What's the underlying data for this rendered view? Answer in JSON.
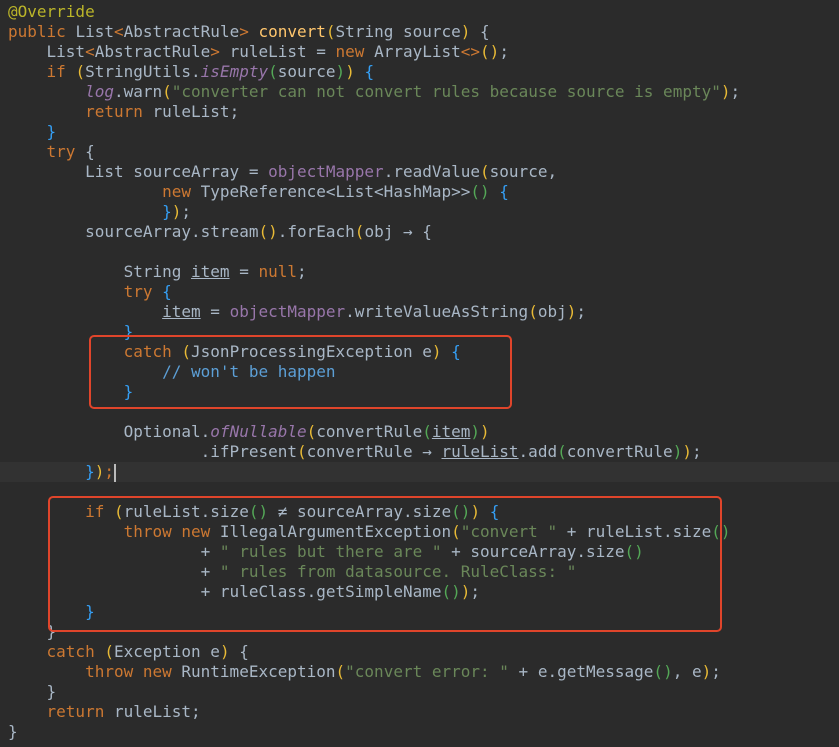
{
  "colors": {
    "background": "#2b2b2b",
    "highlight_box": "#e0452b",
    "keyword": "#cc7832",
    "string": "#6a8759",
    "method": "#ffc66d"
  },
  "current_line": 23,
  "lines": [
    [
      [
        "a",
        "@Override"
      ]
    ],
    [
      [
        "kw",
        "public "
      ],
      [
        "t",
        "List"
      ],
      [
        "kw",
        "<"
      ],
      [
        "t",
        "AbstractRule"
      ],
      [
        "kw",
        "> "
      ],
      [
        "m",
        "convert"
      ],
      [
        "b1",
        "("
      ],
      [
        "t",
        "String source"
      ],
      [
        "b1",
        ")"
      ],
      [
        "t",
        " {"
      ]
    ],
    [
      [
        "t",
        "    List"
      ],
      [
        "kw",
        "<"
      ],
      [
        "t",
        "AbstractRule"
      ],
      [
        "kw",
        "> "
      ],
      [
        "t",
        "ruleList = "
      ],
      [
        "kw",
        "new "
      ],
      [
        "t",
        "ArrayList"
      ],
      [
        "kw",
        "<>"
      ],
      [
        "b1",
        "("
      ],
      [
        "b1",
        ")"
      ],
      [
        "t",
        ";"
      ]
    ],
    [
      [
        "kw",
        "    if "
      ],
      [
        "b1",
        "("
      ],
      [
        "t",
        "StringUtils."
      ],
      [
        "st",
        "isEmpty"
      ],
      [
        "b2",
        "("
      ],
      [
        "t",
        "source"
      ],
      [
        "b2",
        ")"
      ],
      [
        "b1",
        ")"
      ],
      [
        "b3",
        " {"
      ]
    ],
    [
      [
        "t",
        "        "
      ],
      [
        "st",
        "log"
      ],
      [
        "t",
        ".warn"
      ],
      [
        "b1",
        "("
      ],
      [
        "s",
        "\"converter can not convert rules because source is empty\""
      ],
      [
        "b1",
        ")"
      ],
      [
        "t",
        ";"
      ]
    ],
    [
      [
        "kw",
        "        return "
      ],
      [
        "t",
        "ruleList;"
      ]
    ],
    [
      [
        "b3",
        "    }"
      ]
    ],
    [
      [
        "kw",
        "    try "
      ],
      [
        "t",
        "{"
      ]
    ],
    [
      [
        "t",
        "        List sourceArray = "
      ],
      [
        "f",
        "objectMapper"
      ],
      [
        "t",
        ".readValue"
      ],
      [
        "b1",
        "("
      ],
      [
        "t",
        "source,"
      ]
    ],
    [
      [
        "kw",
        "                new "
      ],
      [
        "t",
        "TypeReference<List<HashMap>>"
      ],
      [
        "b2",
        "("
      ],
      [
        "b2",
        ")"
      ],
      [
        "b3",
        " {"
      ]
    ],
    [
      [
        "b3",
        "                }"
      ],
      [
        "b1",
        ")"
      ],
      [
        "t",
        ";"
      ]
    ],
    [
      [
        "t",
        "        sourceArray.stream"
      ],
      [
        "b1",
        "("
      ],
      [
        "b1",
        ")"
      ],
      [
        "t",
        ".forEach"
      ],
      [
        "b1",
        "("
      ],
      [
        "t",
        "obj → {"
      ]
    ],
    [],
    [
      [
        "t",
        "            String "
      ],
      [
        "u",
        "item"
      ],
      [
        "t",
        " = "
      ],
      [
        "kw",
        "null"
      ],
      [
        "t",
        ";"
      ]
    ],
    [
      [
        "kw",
        "            try "
      ],
      [
        "b3",
        "{"
      ]
    ],
    [
      [
        "t",
        "                "
      ],
      [
        "u",
        "item"
      ],
      [
        "t",
        " = "
      ],
      [
        "f",
        "objectMapper"
      ],
      [
        "t",
        ".writeValueAsString"
      ],
      [
        "b1",
        "("
      ],
      [
        "t",
        "obj"
      ],
      [
        "b1",
        ")"
      ],
      [
        "t",
        ";"
      ]
    ],
    [
      [
        "b3",
        "            }"
      ]
    ],
    [
      [
        "kw",
        "            catch "
      ],
      [
        "b1",
        "("
      ],
      [
        "t",
        "JsonProcessingException e"
      ],
      [
        "b1",
        ")"
      ],
      [
        "b3",
        " {"
      ]
    ],
    [
      [
        "c",
        "                // won't be happen"
      ]
    ],
    [
      [
        "b3",
        "            }"
      ]
    ],
    [],
    [
      [
        "t",
        "            Optional."
      ],
      [
        "st",
        "ofNullable"
      ],
      [
        "b1",
        "("
      ],
      [
        "t",
        "convertRule"
      ],
      [
        "b2",
        "("
      ],
      [
        "u",
        "item"
      ],
      [
        "b2",
        ")"
      ],
      [
        "b1",
        ")"
      ]
    ],
    [
      [
        "t",
        "                    .ifPresent"
      ],
      [
        "b1",
        "("
      ],
      [
        "t",
        "convertRule → "
      ],
      [
        "u",
        "ruleList"
      ],
      [
        "t",
        ".add"
      ],
      [
        "b2",
        "("
      ],
      [
        "t",
        "convertRule"
      ],
      [
        "b2",
        ")"
      ],
      [
        "b1",
        ")"
      ],
      [
        "t",
        ";"
      ]
    ],
    [
      [
        "b3",
        "        }"
      ],
      [
        "b1",
        ")"
      ],
      [
        "kw",
        ";"
      ]
    ],
    [],
    [
      [
        "kw",
        "        if "
      ],
      [
        "b1",
        "("
      ],
      [
        "t",
        "ruleList.size"
      ],
      [
        "b2",
        "("
      ],
      [
        "b2",
        ")"
      ],
      [
        "t",
        " ≠ sourceArray.size"
      ],
      [
        "b2",
        "("
      ],
      [
        "b2",
        ")"
      ],
      [
        "b1",
        ")"
      ],
      [
        "b3",
        " {"
      ]
    ],
    [
      [
        "kw",
        "            throw new "
      ],
      [
        "t",
        "IllegalArgumentException"
      ],
      [
        "b1",
        "("
      ],
      [
        "s",
        "\"convert \""
      ],
      [
        "t",
        " + ruleList.size"
      ],
      [
        "b2",
        "("
      ],
      [
        "b2",
        ")"
      ]
    ],
    [
      [
        "t",
        "                    + "
      ],
      [
        "s",
        "\" rules but there are \""
      ],
      [
        "t",
        " + sourceArray.size"
      ],
      [
        "b2",
        "("
      ],
      [
        "b2",
        ")"
      ]
    ],
    [
      [
        "t",
        "                    + "
      ],
      [
        "s",
        "\" rules from datasource. RuleClass: \""
      ]
    ],
    [
      [
        "t",
        "                    + ruleClass.getSimpleName"
      ],
      [
        "b2",
        "("
      ],
      [
        "b2",
        ")"
      ],
      [
        "b1",
        ")"
      ],
      [
        "t",
        ";"
      ]
    ],
    [
      [
        "b3",
        "        }"
      ]
    ],
    [
      [
        "t",
        "    }"
      ]
    ],
    [
      [
        "kw",
        "    catch "
      ],
      [
        "b1",
        "("
      ],
      [
        "t",
        "Exception e"
      ],
      [
        "b1",
        ")"
      ],
      [
        "t",
        " {"
      ]
    ],
    [
      [
        "kw",
        "        throw new "
      ],
      [
        "t",
        "RuntimeException"
      ],
      [
        "b1",
        "("
      ],
      [
        "s",
        "\"convert error: \""
      ],
      [
        "t",
        " + e.getMessage"
      ],
      [
        "b2",
        "("
      ],
      [
        "b2",
        ")"
      ],
      [
        "t",
        ", e"
      ],
      [
        "b1",
        ")"
      ],
      [
        "t",
        ";"
      ]
    ],
    [
      [
        "t",
        "    }"
      ]
    ],
    [
      [
        "kw",
        "    return "
      ],
      [
        "t",
        "ruleList;"
      ]
    ],
    [
      [
        "t",
        "}"
      ]
    ]
  ]
}
